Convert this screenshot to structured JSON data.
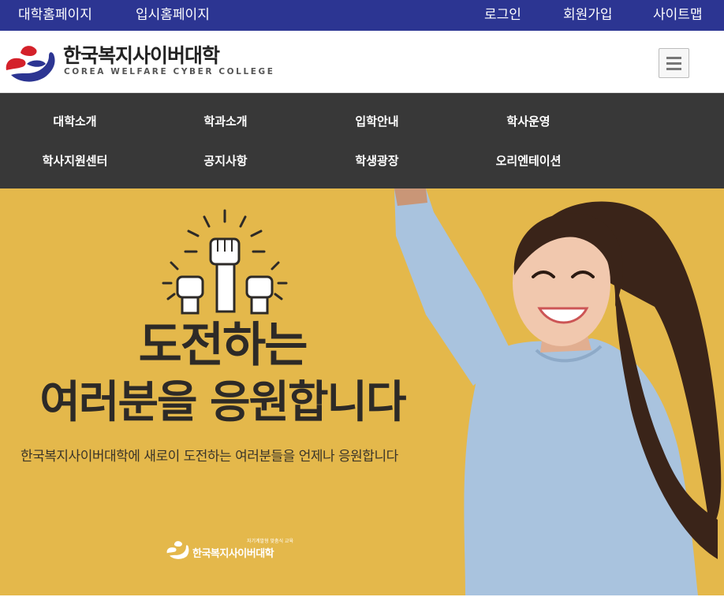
{
  "topbar": {
    "univ_home": "대학홈페이지",
    "admission_home": "입시홈페이지",
    "login": "로그인",
    "signup": "회원가입",
    "sitemap": "사이트맵"
  },
  "header": {
    "logo_korean": "한국복지사이버대학",
    "logo_english": "COREA WELFARE CYBER COLLEGE",
    "menu_icon": "hamburger-menu-icon"
  },
  "nav": {
    "items": [
      {
        "label": "대학소개"
      },
      {
        "label": "학과소개"
      },
      {
        "label": "입학안내"
      },
      {
        "label": "학사운영"
      },
      {
        "label": "학사지원센터"
      },
      {
        "label": "공지사항"
      },
      {
        "label": "학생광장"
      },
      {
        "label": "오리엔테이션"
      }
    ]
  },
  "banner": {
    "headline_line1": "도전하는",
    "headline_line2": "여러분을 응원합니다",
    "subtitle": "한국복지사이버대학에 새로이 도전하는 여러분들을 언제나 응원합니다",
    "small_logo_tag": "자기계발형 맞춤식 교육",
    "small_logo_name": "한국복지사이버대학",
    "illustration_icon": "raised-fists-icon",
    "background_color": "#e4b84b"
  },
  "colors": {
    "topbar": "#2c3592",
    "nav": "#383838",
    "logo_red": "#d4212a",
    "logo_navy": "#2c3592"
  }
}
